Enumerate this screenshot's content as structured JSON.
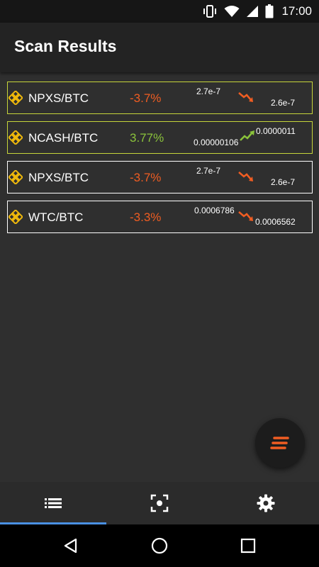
{
  "status_bar": {
    "time": "17:00",
    "icons": [
      "vibrate-icon",
      "wifi-icon",
      "signal-icon",
      "battery-icon"
    ]
  },
  "app_bar": {
    "title": "Scan Results"
  },
  "colors": {
    "up": "#8bc33b",
    "down": "#f05d22",
    "highlight_border": "#c6d63a",
    "coin_icon": "#f0b90b",
    "active_tab": "#4a90e2"
  },
  "results": [
    {
      "pair": "NPXS/BTC",
      "change": "-3.7%",
      "direction": "down",
      "price_from": "2.7e-7",
      "price_to": "2.6e-7",
      "highlighted": true
    },
    {
      "pair": "NCASH/BTC",
      "change": "3.77%",
      "direction": "up",
      "price_from": "0.00000106",
      "price_to": "0.0000011",
      "highlighted": true
    },
    {
      "pair": "NPXS/BTC",
      "change": "-3.7%",
      "direction": "down",
      "price_from": "2.7e-7",
      "price_to": "2.6e-7",
      "highlighted": false
    },
    {
      "pair": "WTC/BTC",
      "change": "-3.3%",
      "direction": "down",
      "price_from": "0.0006786",
      "price_to": "0.0006562",
      "highlighted": false
    }
  ],
  "fab": {
    "icon": "stream-icon"
  },
  "bottom_nav": {
    "items": [
      {
        "icon": "list-icon",
        "active": true
      },
      {
        "icon": "scan-icon",
        "active": false
      },
      {
        "icon": "gear-icon",
        "active": false
      }
    ]
  },
  "system_nav": {
    "icons": [
      "back-icon",
      "home-icon",
      "recents-icon"
    ]
  }
}
